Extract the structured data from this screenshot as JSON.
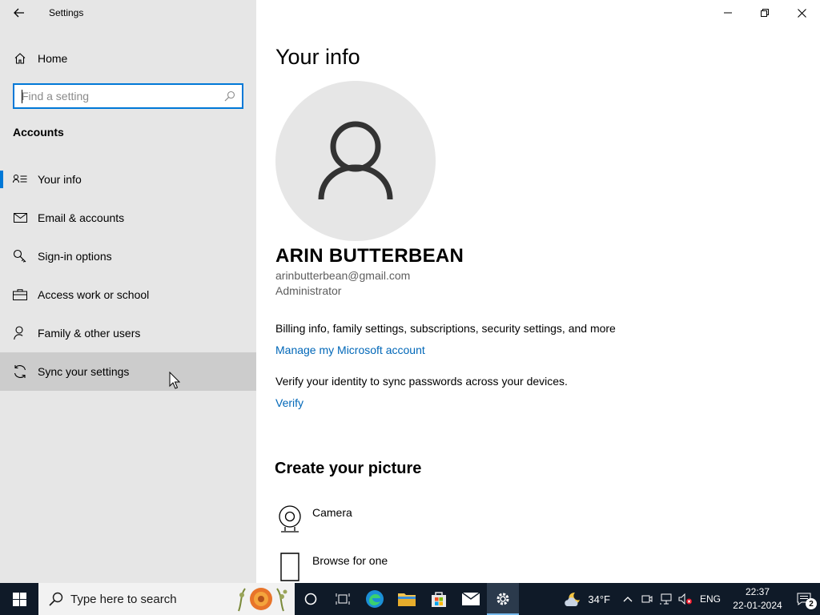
{
  "app": {
    "title": "Settings"
  },
  "sidebar": {
    "home_label": "Home",
    "search_placeholder": "Find a setting",
    "section_heading": "Accounts",
    "items": [
      {
        "label": "Your info",
        "icon": "contact-info-icon",
        "selected": true
      },
      {
        "label": "Email & accounts",
        "icon": "mail-icon",
        "selected": false
      },
      {
        "label": "Sign-in options",
        "icon": "key-icon",
        "selected": false
      },
      {
        "label": "Access work or school",
        "icon": "briefcase-icon",
        "selected": false
      },
      {
        "label": "Family & other users",
        "icon": "person-add-icon",
        "selected": false
      },
      {
        "label": "Sync your settings",
        "icon": "sync-icon",
        "selected": false,
        "hovered": true
      }
    ]
  },
  "main": {
    "page_title": "Your info",
    "user": {
      "name": "ARIN BUTTERBEAN",
      "email": "arinbutterbean@gmail.com",
      "role": "Administrator"
    },
    "billing_text": "Billing info, family settings, subscriptions, security settings, and more",
    "manage_link": "Manage my Microsoft account",
    "verify_text": "Verify your identity to sync passwords across your devices.",
    "verify_link": "Verify",
    "create_heading": "Create your picture",
    "picture_options": [
      {
        "label": "Camera",
        "icon": "camera-icon"
      },
      {
        "label": "Browse for one",
        "icon": "browse-file-icon"
      }
    ]
  },
  "taskbar": {
    "search_placeholder": "Type here to search",
    "weather_temp": "34°F",
    "language": "ENG",
    "time": "22:37",
    "date": "22-01-2024",
    "notification_count": "2"
  },
  "colors": {
    "accent": "#0078d7",
    "link": "#0067b8",
    "sidebar_bg": "#e6e6e6",
    "taskbar_bg": "#0f1a28"
  }
}
